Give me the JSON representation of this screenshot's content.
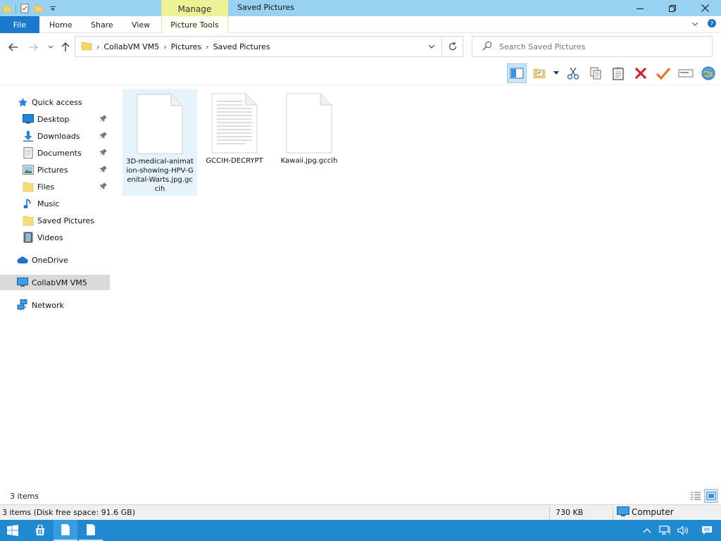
{
  "window": {
    "title": "Saved Pictures",
    "context_tab": "Manage"
  },
  "ribbon": {
    "tabs": [
      "File",
      "Home",
      "Share",
      "View",
      "Picture Tools"
    ]
  },
  "address": {
    "crumbs": [
      "CollabVM VM5",
      "Pictures",
      "Saved Pictures"
    ]
  },
  "search": {
    "placeholder": "Search Saved Pictures"
  },
  "sidebar": {
    "quick_access": "Quick access",
    "pinned": [
      {
        "label": "Desktop",
        "icon": "desktop-icon",
        "pinned": true
      },
      {
        "label": "Downloads",
        "icon": "downloads-icon",
        "pinned": true
      },
      {
        "label": "Documents",
        "icon": "documents-icon",
        "pinned": true
      },
      {
        "label": "Pictures",
        "icon": "pictures-icon",
        "pinned": true
      },
      {
        "label": "Files",
        "icon": "folder-icon",
        "pinned": true
      },
      {
        "label": "Music",
        "icon": "music-icon",
        "pinned": false
      },
      {
        "label": "Saved Pictures",
        "icon": "folder-icon",
        "pinned": false
      },
      {
        "label": "Videos",
        "icon": "videos-icon",
        "pinned": false
      }
    ],
    "onedrive": "OneDrive",
    "this_pc": "CollabVM VM5",
    "network": "Network"
  },
  "files": [
    {
      "name": "3D-medical-animation-showing-HPV-Genital-Warts.jpg.gccih",
      "selected": true,
      "type": "blank"
    },
    {
      "name": "GCCIH-DECRYPT",
      "selected": false,
      "type": "text"
    },
    {
      "name": "Kawaii.jpg.gccih",
      "selected": false,
      "type": "blank"
    }
  ],
  "status": {
    "item_count": "3 items",
    "disk_info": "3 items (Disk free space: 91.6 GB)",
    "size": "730 KB",
    "location": "Computer"
  },
  "colors": {
    "titlebar": "#99d1f3",
    "manage_tab": "#f0f098",
    "file_tab": "#1979ca",
    "taskbar": "#1f8ad2",
    "selection": "#e5f3fb"
  }
}
